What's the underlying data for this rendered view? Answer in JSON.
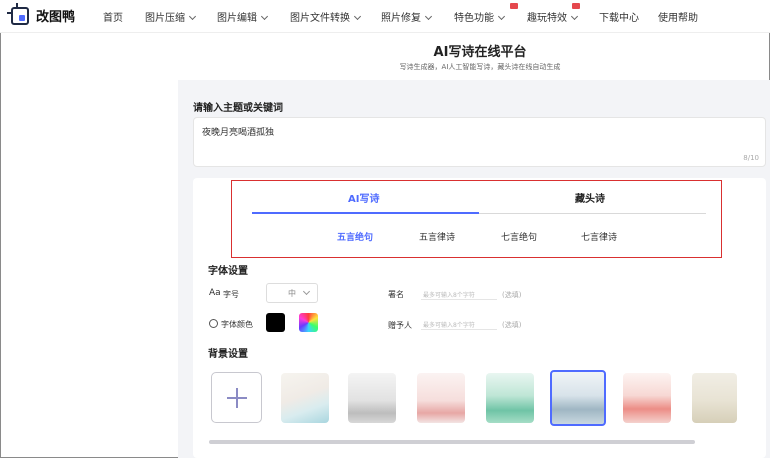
{
  "nav": {
    "logo_text": "改图鸭",
    "items": [
      {
        "label": "首页",
        "has_dropdown": false
      },
      {
        "label": "图片压缩",
        "has_dropdown": true
      },
      {
        "label": "图片编辑",
        "has_dropdown": true
      },
      {
        "label": "图片文件转换",
        "has_dropdown": true
      },
      {
        "label": "照片修复",
        "has_dropdown": true
      },
      {
        "label": "特色功能",
        "has_dropdown": true,
        "badge": true
      },
      {
        "label": "趣玩特效",
        "has_dropdown": true,
        "badge": true
      },
      {
        "label": "下载中心",
        "has_dropdown": false
      },
      {
        "label": "使用帮助",
        "has_dropdown": false
      }
    ]
  },
  "header": {
    "title": "AI写诗在线平台",
    "subtitle": "写诗生成器，AI人工智能写诗，藏头诗在线自动生成"
  },
  "topic": {
    "heading": "请输入主题或关键词",
    "value": "夜晚月亮喝酒孤独",
    "count": "8/10"
  },
  "tabs": {
    "items": [
      "AI写诗",
      "藏头诗"
    ],
    "active_index": 0,
    "sub_items": [
      "五言绝句",
      "五言律诗",
      "七言绝句",
      "七言律诗"
    ],
    "active_sub_index": 0
  },
  "font_settings": {
    "heading": "字体设置",
    "size_prefix": "Aa",
    "size_label": "字号",
    "size_value": "中",
    "color_label": "字体颜色",
    "color_value": "#000000",
    "signature_label": "署名",
    "signature_placeholder": "最多可输入8个字符",
    "signature_optional": "(选填)",
    "recipient_label": "赠予人",
    "recipient_placeholder": "最多可输入8个字符",
    "recipient_optional": "(选填)"
  },
  "background_settings": {
    "heading": "背景设置",
    "selected_index": 4
  },
  "colors": {
    "accent": "#4f6bff",
    "highlight_box": "#d93030",
    "badge": "#e5484d"
  }
}
